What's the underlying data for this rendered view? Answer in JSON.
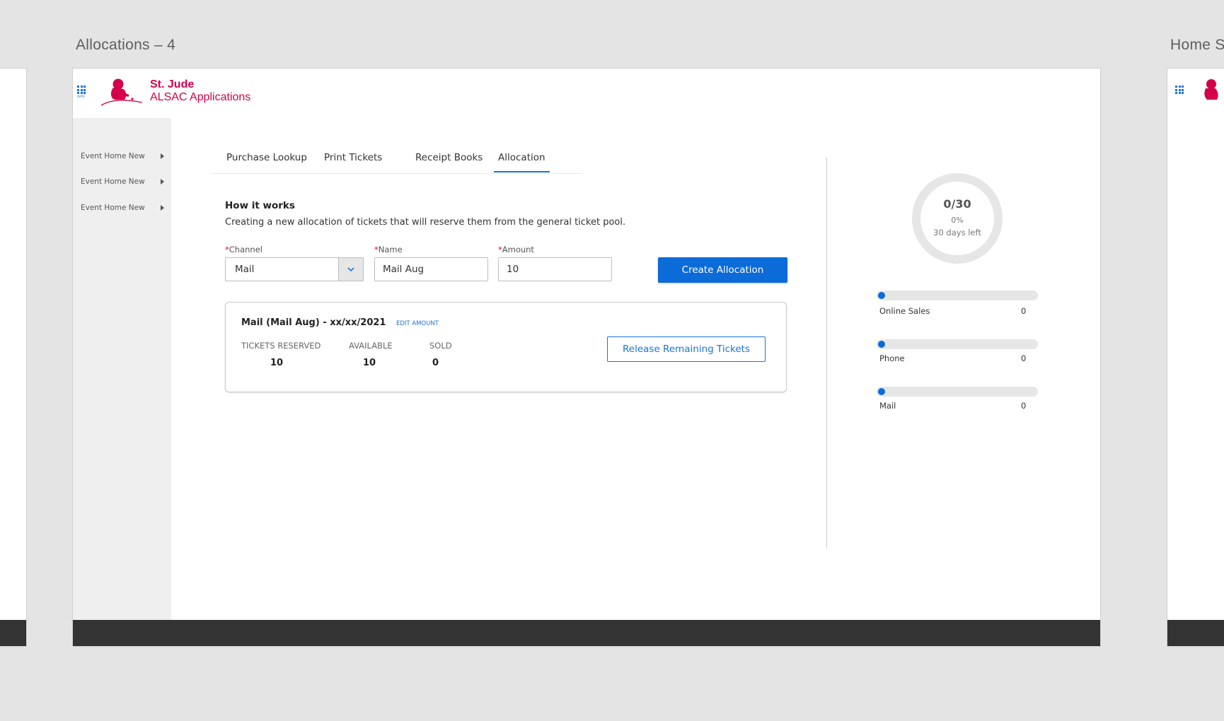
{
  "artboards": {
    "main_title": "Allocations – 4",
    "right_title": "Home S"
  },
  "header": {
    "apps_label": "APPS",
    "brand_line1": "St. Jude",
    "brand_line2": "ALSAC Applications"
  },
  "sidebar": {
    "items": [
      {
        "label": "Event Home New"
      },
      {
        "label": "Event Home New"
      },
      {
        "label": "Event Home New"
      }
    ]
  },
  "tabs": [
    {
      "label": "Purchase Lookup",
      "active": false
    },
    {
      "label": "Print Tickets",
      "active": false
    },
    {
      "label": "Receipt Books",
      "active": false
    },
    {
      "label": "Allocation",
      "active": true
    }
  ],
  "how_it_works": {
    "title": "How it works",
    "description": "Creating a new allocation of tickets that will reserve them from the general ticket pool."
  },
  "form": {
    "required_mark": "*",
    "channel_label": "Channel",
    "channel_value": "Mail",
    "name_label": "Name",
    "name_value": "Mail Aug",
    "amount_label": "Amount",
    "amount_value": "10",
    "create_button": "Create Allocation"
  },
  "allocation_card": {
    "title": "Mail (Mail Aug) - xx/xx/2021",
    "edit_link": "EDIT AMOUNT",
    "stats": [
      {
        "label": "TICKETS RESERVED",
        "value": "10"
      },
      {
        "label": "AVAILABLE",
        "value": "10"
      },
      {
        "label": "SOLD",
        "value": "0"
      }
    ],
    "release_button": "Release Remaining Tickets"
  },
  "summary": {
    "fraction": "0/30",
    "percent": "0%",
    "days_left": "30 days left",
    "progress_fraction": 0,
    "channels": [
      {
        "label": "Online Sales",
        "count": "0",
        "fraction": 0
      },
      {
        "label": "Phone",
        "count": "0",
        "fraction": 0
      },
      {
        "label": "Mail",
        "count": "0",
        "fraction": 0
      }
    ]
  },
  "colors": {
    "brand": "#d4004c",
    "accent": "#0b6bd8",
    "footer": "#333333",
    "canvas": "#e4e4e4"
  }
}
